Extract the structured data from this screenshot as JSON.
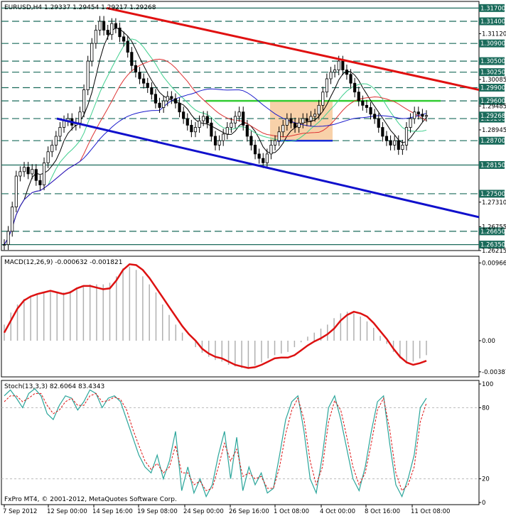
{
  "header": {
    "symbol": "EURUSD,H4",
    "ohlc": "1.29337 1.29454 1.29217 1.29268"
  },
  "footer": {
    "copyright": "FxPro MT4, © 2001-2012, MetaQuotes Software Corp."
  },
  "colors": {
    "background": "#ffffff",
    "grid_border": "#000000",
    "level_line": "#1a6b5b",
    "resistance_trend": "#e01010",
    "support_trend": "#1010cc",
    "horizontal_green": "#33cc33",
    "horizontal_blue": "#1a2bd6",
    "range_box": "#f7c99a",
    "ma_fast": "#000000",
    "ma_mid": "#3fcf8e",
    "ma_red": "#d33",
    "ma_slow": "#1a1acc",
    "macd_line": "#dd1111",
    "macd_hist": "#b0b0b0",
    "stoch_main": "#2aa59a",
    "stoch_signal": "#dd1111",
    "price_box": "#1a6b5b"
  },
  "chart_data": [
    {
      "type": "candlestick",
      "title": "EURUSD,H4",
      "subtitle": "1.29337 1.29454 1.29217 1.29268",
      "ylim": [
        1.26215,
        1.3185
      ],
      "y_ticks": [
        "1.31120",
        "1.30085",
        "1.29485",
        "1.28945",
        "1.27310",
        "1.26755",
        "1.26215"
      ],
      "x_tick_labels": [
        "7 Sep 2012",
        "12 Sep 00:00",
        "14 Sep 16:00",
        "19 Sep 08:00",
        "24 Sep 00:00",
        "26 Sep 16:00",
        "1 Oct 08:00",
        "4 Oct 00:00",
        "8 Oct 16:00",
        "11 Oct 08:00"
      ],
      "levels": [
        {
          "label": "1.31700",
          "value": 1.317,
          "style": "solid"
        },
        {
          "label": "1.31400",
          "value": 1.314,
          "style": "dashed"
        },
        {
          "label": "1.30900",
          "value": 1.309,
          "style": "dashed"
        },
        {
          "label": "1.30500",
          "value": 1.305,
          "style": "dashed"
        },
        {
          "label": "1.30250",
          "value": 1.3025,
          "style": "dashed"
        },
        {
          "label": "1.29900",
          "value": 1.299,
          "style": "dashed"
        },
        {
          "label": "1.29600",
          "value": 1.296,
          "style": "dashed"
        },
        {
          "label": "1.29200",
          "value": 1.292,
          "style": "dashed"
        },
        {
          "label": "1.28700",
          "value": 1.287,
          "style": "dashed"
        },
        {
          "label": "1.28150",
          "value": 1.2815,
          "style": "solid"
        },
        {
          "label": "1.27500",
          "value": 1.275,
          "style": "dashed"
        },
        {
          "label": "1.26650",
          "value": 1.2665,
          "style": "dashed"
        },
        {
          "label": "1.26350",
          "value": 1.2635,
          "style": "solid"
        }
      ],
      "current_price": {
        "label": "1.29268",
        "value": 1.29268
      },
      "close_series": [
        1.2635,
        1.2665,
        1.272,
        1.279,
        1.28,
        1.281,
        1.2795,
        1.2805,
        1.278,
        1.277,
        1.282,
        1.2845,
        1.286,
        1.288,
        1.29,
        1.2915,
        1.292,
        1.2905,
        1.291,
        1.2935,
        1.2985,
        1.305,
        1.309,
        1.312,
        1.314,
        1.312,
        1.311,
        1.3135,
        1.3125,
        1.3105,
        1.3095,
        1.307,
        1.304,
        1.3025,
        1.301,
        1.3,
        1.299,
        1.2975,
        1.2955,
        1.2945,
        1.296,
        1.297,
        1.2965,
        1.2955,
        1.2935,
        1.292,
        1.2905,
        1.289,
        1.29,
        1.2915,
        1.2925,
        1.291,
        1.288,
        1.286,
        1.287,
        1.2885,
        1.29,
        1.291,
        1.2925,
        1.2935,
        1.2905,
        1.288,
        1.286,
        1.284,
        1.283,
        1.282,
        1.284,
        1.286,
        1.287,
        1.289,
        1.2905,
        1.292,
        1.291,
        1.29,
        1.291,
        1.292,
        1.2915,
        1.2925,
        1.293,
        1.295,
        1.298,
        1.301,
        1.3025,
        1.303,
        1.305,
        1.303,
        1.302,
        1.3,
        1.298,
        1.296,
        1.295,
        1.2945,
        1.293,
        1.292,
        1.29,
        1.288,
        1.287,
        1.286,
        1.287,
        1.285,
        1.286,
        1.29,
        1.292,
        1.2935,
        1.293,
        1.2925,
        1.2927
      ]
    },
    {
      "type": "line",
      "title": "MACD(12,26,9) -0.000632 -0.001821",
      "y_tick_labels": [
        "0.00966",
        "0.00",
        "-0.00387"
      ],
      "ylim": [
        -0.0045,
        0.0105
      ],
      "series": [
        {
          "name": "signal",
          "values": [
            0.001,
            0.0025,
            0.004,
            0.005,
            0.0055,
            0.0058,
            0.006,
            0.0062,
            0.006,
            0.0058,
            0.006,
            0.0065,
            0.0068,
            0.0068,
            0.0066,
            0.0064,
            0.0065,
            0.0075,
            0.0088,
            0.0095,
            0.0094,
            0.0088,
            0.0078,
            0.0066,
            0.0054,
            0.0042,
            0.003,
            0.0018,
            0.0008,
            0.0,
            -0.001,
            -0.0016,
            -0.002,
            -0.0022,
            -0.0026,
            -0.003,
            -0.0032,
            -0.0034,
            -0.0033,
            -0.003,
            -0.0026,
            -0.0022,
            -0.0021,
            -0.0021,
            -0.0018,
            -0.0012,
            -0.0006,
            -0.0001,
            0.0003,
            0.0008,
            0.0015,
            0.0025,
            0.0032,
            0.0036,
            0.0034,
            0.003,
            0.0022,
            0.0012,
            0.0002,
            -0.001,
            -0.002,
            -0.0027,
            -0.003,
            -0.0028,
            -0.0025
          ]
        },
        {
          "name": "histogram",
          "values": [
            0.002,
            0.0035,
            0.0045,
            0.0052,
            0.0056,
            0.0058,
            0.006,
            0.0062,
            0.0061,
            0.006,
            0.0062,
            0.0066,
            0.0068,
            0.007,
            0.007,
            0.007,
            0.0072,
            0.008,
            0.009,
            0.0092,
            0.0088,
            0.008,
            0.007,
            0.006,
            0.0045,
            0.0032,
            0.002,
            0.001,
            0.0,
            -0.0008,
            -0.0015,
            -0.002,
            -0.0024,
            -0.0026,
            -0.003,
            -0.0032,
            -0.0034,
            -0.0034,
            -0.0031,
            -0.0027,
            -0.0022,
            -0.0018,
            -0.0016,
            -0.0014,
            -0.0008,
            -0.0002,
            0.0005,
            0.001,
            0.0015,
            0.002,
            0.0028,
            0.0034,
            0.0036,
            0.0034,
            0.003,
            0.0024,
            0.0016,
            0.0006,
            -0.0004,
            -0.0014,
            -0.0022,
            -0.0026,
            -0.0026,
            -0.0022,
            -0.0018
          ]
        }
      ]
    },
    {
      "type": "line",
      "title": "Stoch(13,3,3) 82.6064 83.4343",
      "y_tick_labels": [
        "100",
        "80",
        "20",
        "0"
      ],
      "ylim": [
        0,
        100
      ],
      "series": [
        {
          "name": "main",
          "values": [
            90,
            95,
            88,
            80,
            92,
            96,
            90,
            75,
            70,
            82,
            90,
            88,
            78,
            85,
            95,
            92,
            80,
            88,
            90,
            85,
            70,
            55,
            40,
            30,
            25,
            40,
            20,
            35,
            60,
            10,
            30,
            8,
            20,
            5,
            15,
            40,
            60,
            20,
            55,
            10,
            30,
            15,
            25,
            8,
            12,
            40,
            70,
            85,
            90,
            60,
            20,
            8,
            40,
            80,
            90,
            70,
            45,
            20,
            10,
            30,
            60,
            85,
            90,
            50,
            15,
            5,
            20,
            40,
            80,
            88
          ]
        },
        {
          "name": "signal",
          "values": [
            85,
            90,
            90,
            85,
            88,
            92,
            92,
            82,
            75,
            78,
            85,
            88,
            82,
            82,
            90,
            92,
            85,
            86,
            89,
            87,
            78,
            62,
            48,
            35,
            28,
            33,
            25,
            30,
            48,
            25,
            25,
            15,
            18,
            10,
            12,
            30,
            50,
            35,
            45,
            22,
            25,
            20,
            22,
            12,
            12,
            30,
            58,
            78,
            88,
            70,
            35,
            15,
            30,
            68,
            86,
            78,
            55,
            30,
            15,
            25,
            50,
            78,
            88,
            62,
            25,
            10,
            15,
            30,
            68,
            84
          ]
        }
      ]
    }
  ]
}
